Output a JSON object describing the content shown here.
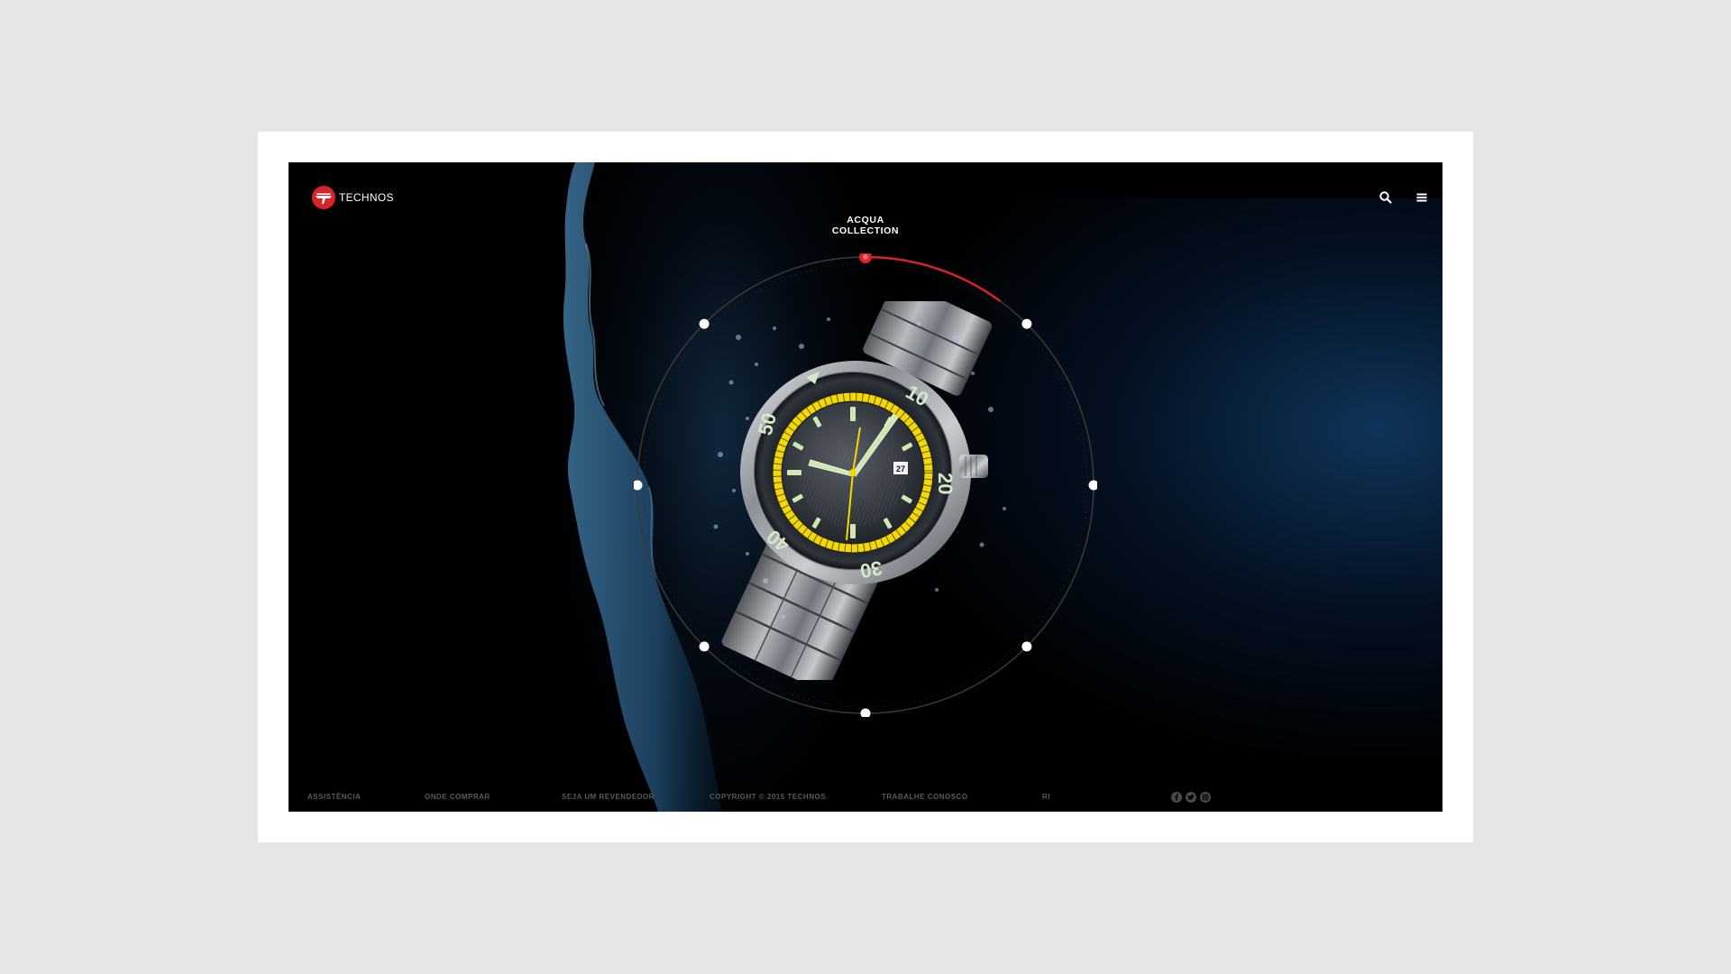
{
  "header": {
    "brand": "TECHNOS",
    "search_icon": "search-icon",
    "menu_icon": "hamburger-menu-icon"
  },
  "hero": {
    "collection_line1": "ACQUA",
    "collection_line2": "COLLECTION",
    "progress": 0.1,
    "bezel_numbers": [
      "10",
      "20",
      "30",
      "40",
      "50"
    ],
    "date_window": "27"
  },
  "footer": {
    "links": [
      "ASSISTÊNCIA",
      "ONDE COMPRAR",
      "SEJA UM REVENDEDOR",
      "COPYRIGHT © 2015 TECHNOS.",
      "TRABALHE CONOSCO",
      "RI"
    ],
    "social": [
      "facebook-icon",
      "twitter-icon",
      "instagram-icon"
    ]
  },
  "colors": {
    "accent_red": "#d8232a",
    "bezel_yellow": "#f5d800",
    "lume_green": "#cfe8b0"
  }
}
